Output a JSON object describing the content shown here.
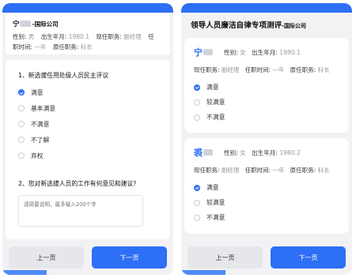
{
  "left": {
    "header": {
      "name_surname": "宁",
      "org": "-国际公司",
      "gender_label": "性别:",
      "gender": "男",
      "birth_label": "出生年月:",
      "birth": "1980.1",
      "position_label": "现任职务:",
      "position": "副经理",
      "tenure_label_prefix": "任",
      "tenure_label": "职时间:",
      "tenure": "一年",
      "prev_position_label": "原任职务:",
      "prev_position": "科长"
    },
    "q1": {
      "title": "1、新选拔任用处级人员民主评议",
      "options": [
        "满意",
        "基本满意",
        "不满意",
        "不了解",
        "弃权"
      ]
    },
    "q2": {
      "title": "2、您对新选拔人员的工作有何意见和建议?",
      "placeholder": "请简要说明，最多输入200个字"
    },
    "buttons": {
      "prev": "上一页",
      "next": "下一页"
    }
  },
  "right": {
    "title": "领导人员廉洁自律专项测评",
    "org": "-国际公司",
    "people": [
      {
        "surname": "宁",
        "gender_label": "性别:",
        "gender": "女",
        "birth_label": "出生年月:",
        "birth": "1980.1",
        "position_label": "现任职务:",
        "position": "副经理",
        "tenure_label": "任职时间:",
        "tenure": "一年",
        "prev_label": "原任职务:",
        "prev": "科长",
        "options": [
          "满意",
          "较满意",
          "不满意"
        ]
      },
      {
        "surname": "裘",
        "gender_label": "性别:",
        "gender": "女",
        "birth_label": "出生年月:",
        "birth": "1980.2",
        "position_label": "现任职务:",
        "position": "副经理",
        "tenure_label": "任职时间:",
        "tenure": "一年",
        "prev_label": "原任职务:",
        "prev": "科长",
        "options": [
          "满意",
          "较满意",
          "不满意"
        ]
      }
    ],
    "buttons": {
      "prev": "上一页",
      "next": "下一页"
    }
  },
  "colors": {
    "primary": "#2d6ff5",
    "muted": "#999999",
    "background": "#f2f2f4"
  }
}
